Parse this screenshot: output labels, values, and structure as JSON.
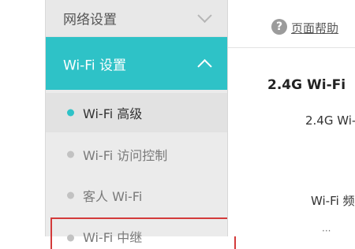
{
  "sidebar": {
    "network_settings": {
      "label": "网络设置"
    },
    "wifi_settings": {
      "label": "Wi-Fi 设置"
    },
    "sub_items": [
      {
        "label": "Wi-Fi 高级"
      },
      {
        "label": "Wi-Fi 访问控制"
      },
      {
        "label": "客人 Wi-Fi"
      },
      {
        "label": "Wi-Fi 中继"
      }
    ]
  },
  "content": {
    "help_link": "页面帮助",
    "band_title": "2.4G Wi-Fi",
    "band_line": "2.4G Wi-",
    "wifi_freq": "Wi-Fi 频",
    "bottom_fragment": "···"
  },
  "colors": {
    "accent": "#2ec2c7",
    "highlight_red": "#d33a3a"
  }
}
